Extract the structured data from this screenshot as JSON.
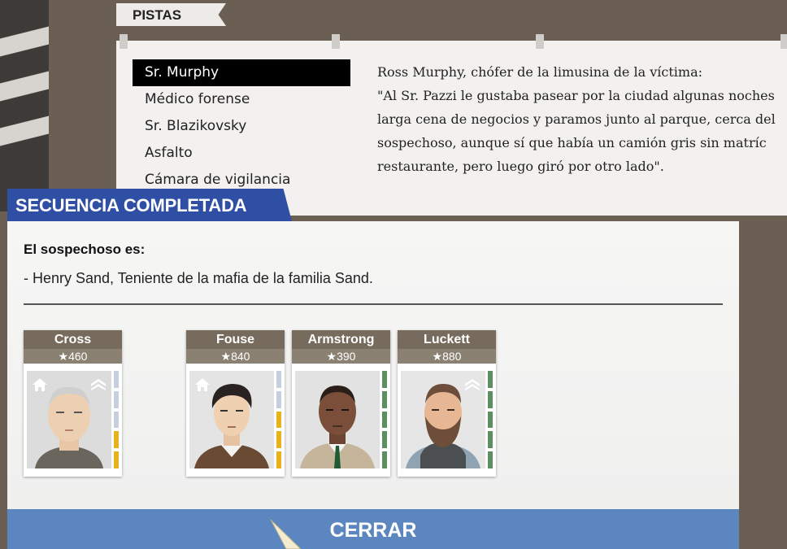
{
  "pistas": {
    "title": "PISTAS",
    "items": [
      {
        "label": "Sr. Murphy",
        "selected": true
      },
      {
        "label": "Médico forense",
        "selected": false
      },
      {
        "label": "Sr. Blazikovsky",
        "selected": false
      },
      {
        "label": "Asfalto",
        "selected": false
      },
      {
        "label": "Cámara de vigilancia",
        "selected": false
      }
    ],
    "text_lines": [
      "Ross Murphy, chófer de la limusina de la víctima:",
      "\"Al Sr. Pazzi le gustaba pasear por la ciudad algunas noches",
      "larga cena de negocios y paramos junto al parque, cerca del",
      "sospechoso, aunque sí que había un camión gris sin matríc",
      "restaurante, pero luego giró por otro lado\"."
    ]
  },
  "dialog": {
    "banner": "SECUENCIA COMPLETADA",
    "suspect_label": "El sospechoso es:",
    "suspect_desc": "- Henry Sand, Teniente de la mafia de la familia Sand.",
    "close_label": "CERRAR"
  },
  "cards": [
    {
      "name": "Cross",
      "score": "460",
      "home": true,
      "rank": true,
      "bars": [
        "#c5cfdd",
        "#c5cfdd",
        "#c5cfdd",
        "#e8b21c",
        "#e8b21c"
      ]
    },
    {
      "name": "Fouse",
      "score": "840",
      "home": true,
      "rank": false,
      "bars": [
        "#c5cfdd",
        "#c5cfdd",
        "#e8b21c",
        "#e8b21c",
        "#e8b21c"
      ]
    },
    {
      "name": "Armstrong",
      "score": "390",
      "home": false,
      "rank": false,
      "bars": [
        "#5e8f63",
        "#5e8f63",
        "#5e8f63",
        "#5e8f63",
        "#5e8f63"
      ]
    },
    {
      "name": "Luckett",
      "score": "880",
      "home": false,
      "rank": true,
      "bars": [
        "#5e8f63",
        "#5e8f63",
        "#5e8f63",
        "#5e8f63",
        "#5e8f63"
      ]
    }
  ],
  "colors": {
    "banner_blue": "#2e4fa3",
    "close_blue": "#5b86c0",
    "card_header": "#766b5d"
  }
}
